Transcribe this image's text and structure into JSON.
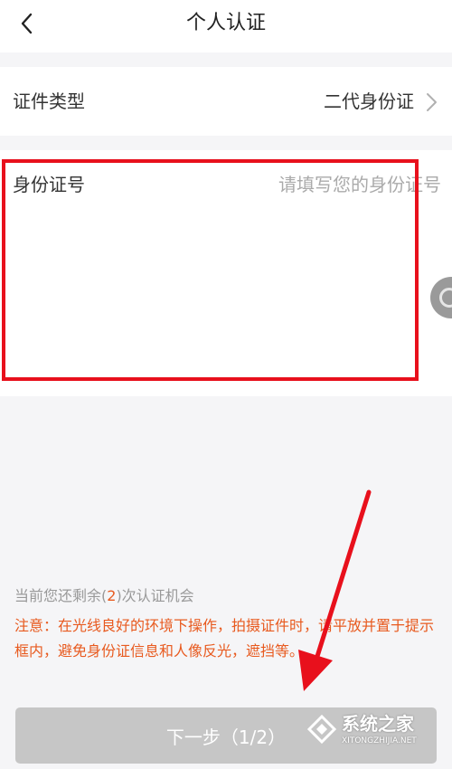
{
  "header": {
    "title": "个人认证",
    "back_icon": "chevron-left-icon"
  },
  "document_type": {
    "label": "证件类型",
    "value": "二代身份证",
    "icon": "chevron-right-icon"
  },
  "id_number": {
    "label": "身份证号",
    "placeholder": "请填写您的身份证号",
    "value": ""
  },
  "remaining": {
    "prefix": "当前您还剩余(",
    "count": "2",
    "suffix": ")次认证机会"
  },
  "notice": "注意：在光线良好的环境下操作，拍摄证件时，请平放并置于提示框内，避免身份证信息和人像反光，遮挡等。",
  "next_button": {
    "label": "下一步（1/2）"
  },
  "watermark": {
    "text": "系统之家",
    "sub": "XITONGZHIJIA.NET"
  },
  "colors": {
    "annotation_red": "#e8101c",
    "notice_orange": "#e85a1f",
    "button_disabled": "#c6c6c6",
    "background": "#f5f5f7"
  }
}
